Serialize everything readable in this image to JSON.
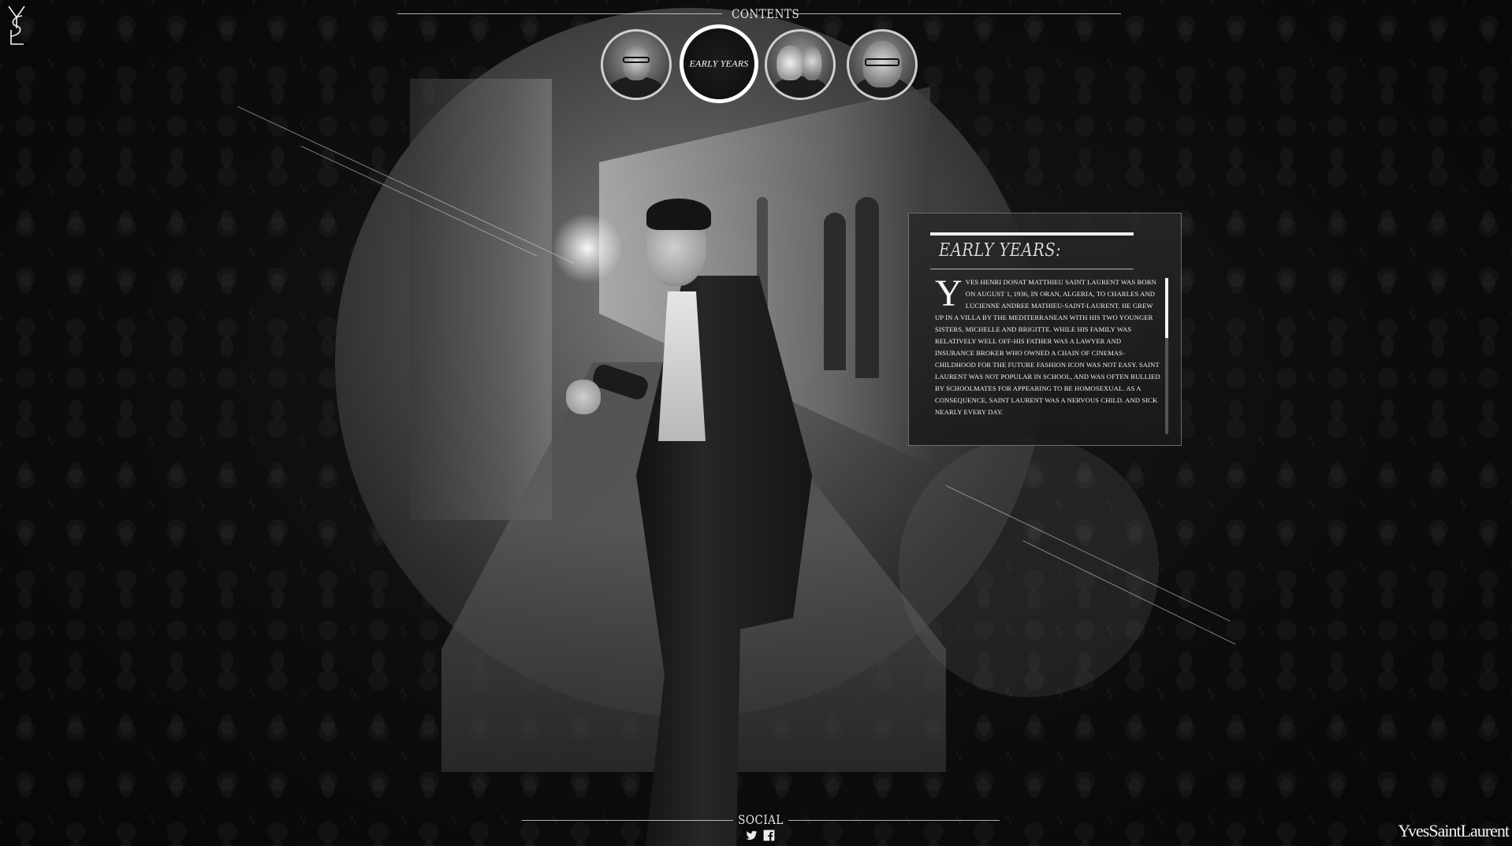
{
  "header": {
    "contents_label": "CONTENTS",
    "active_section_label": "EARLY YEARS",
    "thumbnails": [
      {
        "icon": "portrait-glasses-icon"
      },
      {
        "icon": "early-years-icon"
      },
      {
        "icon": "portrait-pair-icon"
      },
      {
        "icon": "portrait-closeup-icon"
      }
    ]
  },
  "panel": {
    "heading": "EARLY YEARS:",
    "dropcap": "Y",
    "body": "VES HENRI DONAT MATTHIEU SAINT LAURENT WAS BORN ON AUGUST 1, 1936, IN ORAN, ALGERIA, TO CHARLES AND LUCIENNE ANDREE MATHIEU-SAINT-LAURENT. HE GREW UP IN A VILLA BY THE MEDITERRANEAN WITH HIS TWO YOUNGER SISTERS, MICHELLE AND BRIGITTE. WHILE HIS FAMILY WAS RELATIVELY WELL OFF-HIS FATHER WAS A LAWYER AND INSURANCE BROKER WHO OWNED A CHAIN OF CINEMAS-CHILDHOOD FOR THE FUTURE FASHION ICON WAS NOT EASY. SAINT LAURENT WAS NOT POPULAR IN SCHOOL, AND WAS OFTEN BULLIED BY SCHOOLMATES FOR APPEARING TO BE HOMOSEXUAL. AS A CONSEQUENCE, SAINT LAURENT WAS A NERVOUS CHILD. AND SICK NEARLY EVERY DAY."
  },
  "footer": {
    "social_label": "SOCIAL",
    "brand": "YvesSaintLaurent",
    "icons": [
      "twitter-icon",
      "facebook-icon"
    ]
  },
  "logo": {
    "monogram": "YSL"
  },
  "colors": {
    "background": "#0b0b0b",
    "accent": "#ffffff",
    "panel": "#2a2a2a"
  }
}
